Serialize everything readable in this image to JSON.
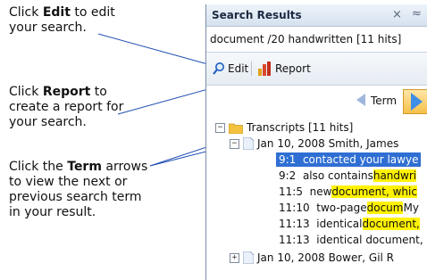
{
  "callouts": {
    "edit": {
      "pre": "Click ",
      "bold": "Edit",
      "post": " to edit your search."
    },
    "report": {
      "pre": "Click ",
      "bold": "Report",
      "post": " to create a report for your search."
    },
    "term": {
      "pre": "Click the ",
      "bold": "Term",
      "post": " arrows to view the next or previous search term in your result."
    }
  },
  "panel": {
    "title": "Search Results",
    "close_glyph": "×",
    "collapse_glyph": "≈",
    "query": "document /20 handwritten [11 hits]",
    "toolbar": {
      "edit_label": "Edit",
      "report_label": "Report"
    },
    "nav": {
      "label": "Term"
    },
    "tree": {
      "root_label": "Transcripts [11 hits]",
      "doc1_label": "Jan 10, 2008   Smith, James",
      "hits": [
        {
          "loc": "9:1",
          "before": "contacted your lawye",
          "match": "",
          "after": ""
        },
        {
          "loc": "9:2",
          "before": "also contains ",
          "match": "handwri",
          "after": ""
        },
        {
          "loc": "11:5",
          "before": "new ",
          "match": "document, whic",
          "after": ""
        },
        {
          "loc": "11:10",
          "before": "two-page ",
          "match": "docum",
          "after": "My"
        },
        {
          "loc": "11:13",
          "before": "identical ",
          "match": "document,",
          "after": ""
        },
        {
          "loc": "11:13",
          "before": "identical document,",
          "match": "",
          "after": ""
        }
      ],
      "doc2_label": "Jan 10, 2008   Bower, Gil R"
    }
  },
  "colors": {
    "highlight": "#fff200",
    "selection": "#2f6fd3",
    "leader": "#1f4fb4"
  }
}
